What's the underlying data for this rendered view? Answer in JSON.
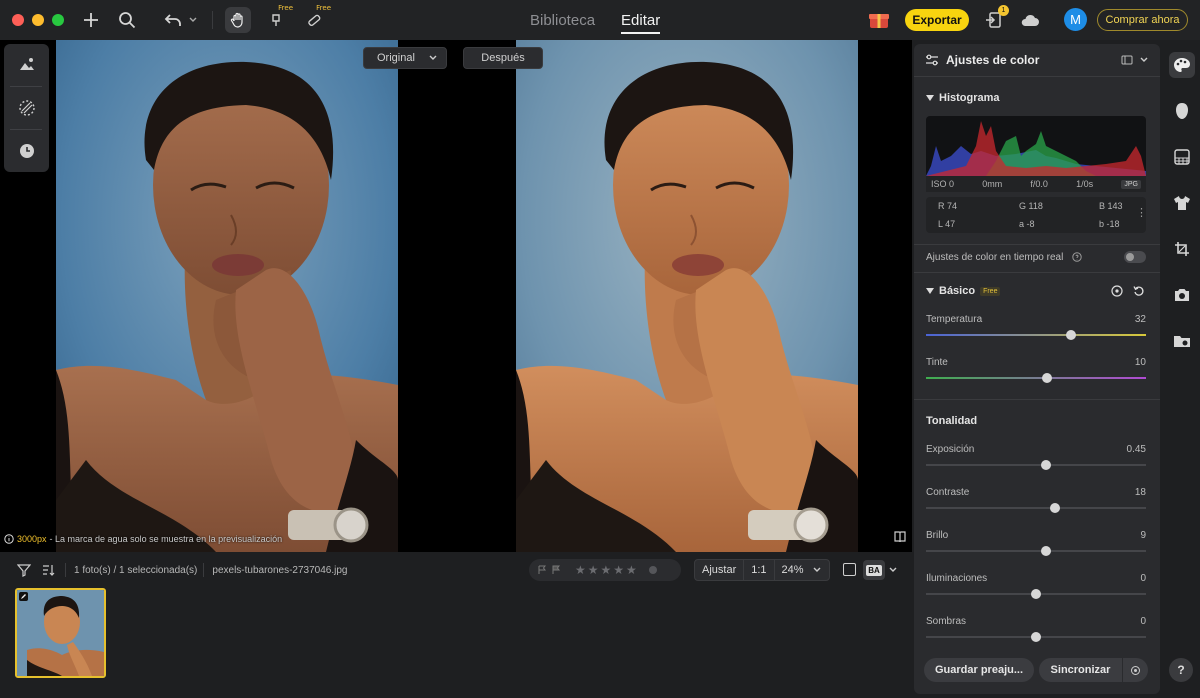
{
  "topbar": {
    "tabs": [
      {
        "label": "Biblioteca",
        "active": false
      },
      {
        "label": "Editar",
        "active": true
      }
    ],
    "free_tag_1": "Free",
    "free_tag_2": "Free",
    "notification_count": "1",
    "export_label": "Exportar",
    "avatar_letter": "M",
    "buy_label": "Comprar ahora",
    "colors": {
      "export": "#f8d40f",
      "avatar": "#1e8de6",
      "accent": "#e6c02d"
    }
  },
  "left_tools": [
    "landscape-tool-icon",
    "mask-tool-icon",
    "history-icon"
  ],
  "canvas": {
    "before_label": "Original",
    "after_label": "Después",
    "watermark_size": "3000px",
    "watermark_text": " - La marca de agua solo se muestra en la previsualización"
  },
  "filmstrip": {
    "selection_info": "1 foto(s) / 1 seleccionada(s)",
    "filename": "pexels-tubarones-2737046.jpg",
    "fit_label": "Ajustar",
    "ratio_label": "1:1",
    "zoom_label": "24%",
    "compare_badge": "BA",
    "rating": 0
  },
  "panel": {
    "title": "Ajustes de color",
    "histogram_title": "Histograma",
    "iso": "ISO 0",
    "focal": "0mm",
    "aperture": "f/0.0",
    "shutter": "1/0s",
    "format": "JPG",
    "r": "R 74",
    "g": "G 118",
    "b": "B 143",
    "l": "L 47",
    "a": "a -8",
    "bb": "b -18",
    "realtime_label": "Ajustes de color en tiempo real",
    "basic_title": "Básico",
    "basic_free": "Free",
    "tonality_title": "Tonalidad",
    "sliders": [
      {
        "label": "Temperatura",
        "value": "32"
      },
      {
        "label": "Tinte",
        "value": "10"
      },
      {
        "label": "Exposición",
        "value": "0.45"
      },
      {
        "label": "Contraste",
        "value": "18"
      },
      {
        "label": "Brillo",
        "value": "9"
      },
      {
        "label": "Iluminaciones",
        "value": "0"
      },
      {
        "label": "Sombras",
        "value": "0"
      }
    ],
    "save_preset_label": "Guardar preaju...",
    "sync_label": "Sincronizar"
  },
  "right_strip": [
    "palette-icon",
    "face-retouch-icon",
    "texture-icon",
    "clothing-icon",
    "crop-icon",
    "camera-icon",
    "folder-view-icon"
  ],
  "help_label": "?"
}
